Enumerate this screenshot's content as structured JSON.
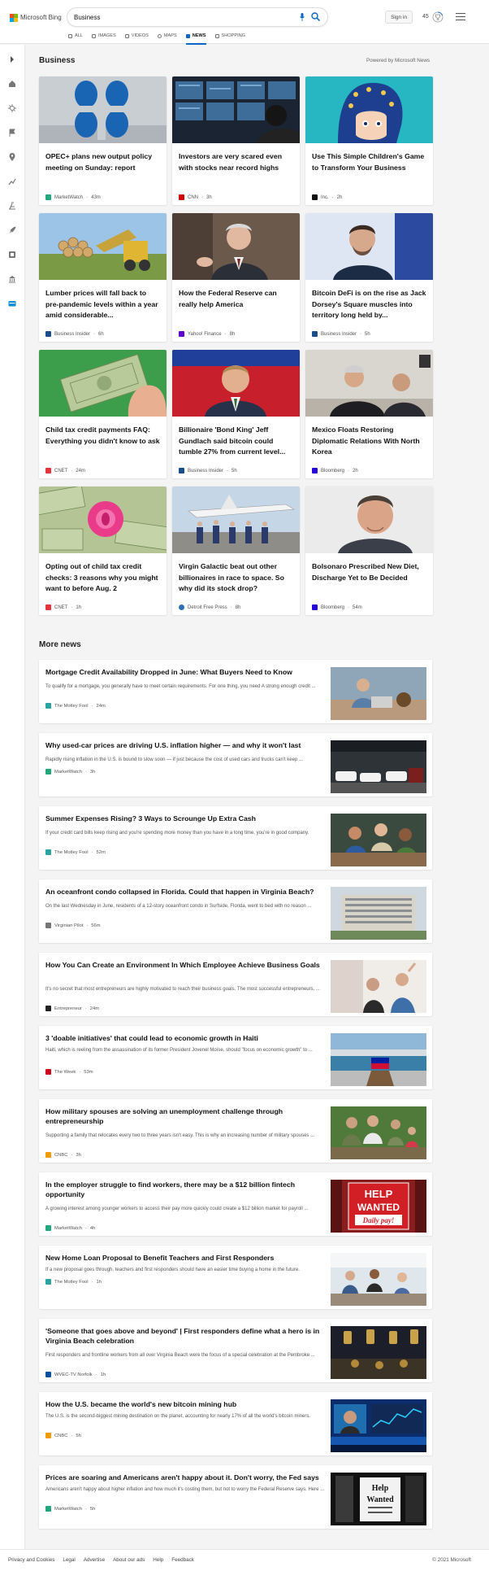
{
  "header": {
    "brand": "Microsoft Bing",
    "search_value": "Business",
    "signin_label": "Sign in",
    "rewards_points": "45",
    "tabs": [
      {
        "label": "ALL"
      },
      {
        "label": "IMAGES"
      },
      {
        "label": "VIDEOS"
      },
      {
        "label": "MAPS"
      },
      {
        "label": "NEWS"
      },
      {
        "label": "SHOPPING"
      }
    ],
    "active_tab": "NEWS"
  },
  "rail": [
    "expand-icon",
    "home-icon",
    "coronavirus-icon",
    "flag-icon",
    "location-icon",
    "chart-icon",
    "science-icon",
    "rocket-icon",
    "entertainment-icon",
    "politics-icon",
    "business-icon"
  ],
  "section": {
    "title": "Business",
    "powered_by": "Powered by Microsoft News"
  },
  "cards": [
    {
      "title": "OPEC+ plans new output policy meeting on Sunday: report",
      "source": "MarketWatch",
      "time": "43m",
      "logo_color": "#22a77a"
    },
    {
      "title": "Investors are very scared even with stocks near record highs",
      "source": "CNN",
      "time": "3h",
      "logo_color": "#cc0000"
    },
    {
      "title": "Use This Simple Children's Game to Transform Your Business",
      "source": "Inc.",
      "time": "2h",
      "logo_color": "#111111"
    },
    {
      "title": "Lumber prices will fall back to pre-pandemic levels within a year amid considerable...",
      "source": "Business Insider",
      "time": "6h",
      "logo_color": "#1a4e8a"
    },
    {
      "title": "How the Federal Reserve can really help America",
      "source": "Yahoo! Finance",
      "time": "8h",
      "logo_color": "#6001d2"
    },
    {
      "title": "Bitcoin DeFi is on the rise as Jack Dorsey's Square muscles into territory long held by...",
      "source": "Business Insider",
      "time": "5h",
      "logo_color": "#1a4e8a"
    },
    {
      "title": "Child tax credit payments FAQ: Everything you didn't know to ask",
      "source": "CNET",
      "time": "24m",
      "logo_color": "#e4333a"
    },
    {
      "title": "Billionaire 'Bond King' Jeff Gundlach said bitcoin could tumble 27% from current level...",
      "source": "Business Insider",
      "time": "5h",
      "logo_color": "#1a4e8a"
    },
    {
      "title": "Mexico Floats Restoring Diplomatic Relations With North Korea",
      "source": "Bloomberg",
      "time": "2h",
      "logo_color": "#2800d7"
    },
    {
      "title": "Opting out of child tax credit checks: 3 reasons why you might want to before Aug. 2",
      "source": "CNET",
      "time": "1h",
      "logo_color": "#e4333a"
    },
    {
      "title": "Virgin Galactic beat out other billionaires in race to space. So why did its stock drop?",
      "source": "Detroit Free Press",
      "time": "8h",
      "logo_color": "#2f6fb3"
    },
    {
      "title": "Bolsonaro Prescribed New Diet, Discharge Yet to Be Decided",
      "source": "Bloomberg",
      "time": "54m",
      "logo_color": "#2800d7"
    }
  ],
  "more_news": {
    "title": "More news",
    "items": [
      {
        "title": "Mortgage Credit Availability Dropped in June: What Buyers Need to Know",
        "snippet": "To qualify for a mortgage, you generally have to meet certain requirements. For one thing, you need A strong enough credit ...",
        "source": "The Motley Fool",
        "time": "24m",
        "logo_color": "#2aa3a5"
      },
      {
        "title": "Why used-car prices are driving U.S. inflation higher — and why it won't last",
        "snippet": "Rapidly rising inflation in the U.S. is bound to slow soon — if just because the cost of used cars and trucks can't keep ...",
        "source": "MarketWatch",
        "time": "3h",
        "logo_color": "#22a77a"
      },
      {
        "title": "Summer Expenses Rising? 3 Ways to Scrounge Up Extra Cash",
        "snippet": "If your credit card bills keep rising and you're spending more money than you have in a long time, you're in good company.",
        "source": "The Motley Fool",
        "time": "52m",
        "logo_color": "#2aa3a5"
      },
      {
        "title": "An oceanfront condo collapsed in Florida. Could that happen in Virginia Beach?",
        "snippet": "On the last Wednesday in June, residents of a 12-story oceanfront condo in Surfside, Florida, went to bed with no reason ...",
        "source": "Virginian Pilot",
        "time": "56m",
        "logo_color": "#777777"
      },
      {
        "title": "How You Can Create an Environment In Which Employee Achieve Business Goals",
        "snippet": "It's no secret that most entrepreneurs are highly motivated to reach their business goals. The most successful entrepreneurs, ...",
        "source": "Entrepreneur",
        "time": "24m",
        "logo_color": "#222222"
      },
      {
        "title": "3 'doable initiatives' that could lead to economic growth in Haiti",
        "snippet": "Haiti, which is reeling from the assassination of its former President Jovenel Moïse, should \"focus on economic growth\" to ...",
        "source": "The Week",
        "time": "53m",
        "logo_color": "#d0021b"
      },
      {
        "title": "How military spouses are solving an unemployment challenge through entrepreneurship",
        "snippet": "Supporting a family that relocates every two to three years isn't easy. This is why an increasing number of military spouses ...",
        "source": "CNBC",
        "time": "3h",
        "logo_color": "#f29b00"
      },
      {
        "title": "In the employer struggle to find workers, there may be a $12 billion fintech opportunity",
        "snippet": "A growing interest among younger workers to access their pay more quickly could create a $12 billion market for payroll ...",
        "source": "MarketWatch",
        "time": "4h",
        "logo_color": "#22a77a"
      },
      {
        "title": "New Home Loan Proposal to Benefit Teachers and First Responders",
        "snippet": "If a new proposal goes through, teachers and first responders should have an easier time buying a home in the future.",
        "source": "The Motley Fool",
        "time": "1h",
        "logo_color": "#2aa3a5"
      },
      {
        "title": "'Someone that goes above and beyond' | First responders define what a hero is in Virginia Beach celebration",
        "snippet": "First responders and frontline workers from all over Virginia Beach were the focus of a special celebration at the Pembroke ...",
        "source": "WVEC-TV Norfolk",
        "time": "1h",
        "logo_color": "#0050a0"
      },
      {
        "title": "How the U.S. became the world's new bitcoin mining hub",
        "snippet": "The U.S. is the second-biggest mining destination on the planet, accounting for nearly 17% of all the world's bitcoin miners.",
        "source": "CNBC",
        "time": "5h",
        "logo_color": "#f29b00"
      },
      {
        "title": "Prices are soaring and Americans aren't happy about it. Don't worry, the Fed says",
        "snippet": "Americans aren't happy about higher inflation and how much it's costing them, but not to worry the Federal Reserve says. Here ...",
        "source": "MarketWatch",
        "time": "5h",
        "logo_color": "#22a77a"
      }
    ]
  },
  "thumb_text": {
    "help_wanted_1": "HELP",
    "help_wanted_2": "WANTED",
    "help_wanted_3": "Daily pay!",
    "help_sign_1": "Help",
    "help_sign_2": "Wanted"
  },
  "footer": {
    "links": [
      "Privacy and Cookies",
      "Legal",
      "Advertise",
      "About our ads",
      "Help",
      "Feedback"
    ],
    "copyright": "© 2021 Microsoft"
  }
}
